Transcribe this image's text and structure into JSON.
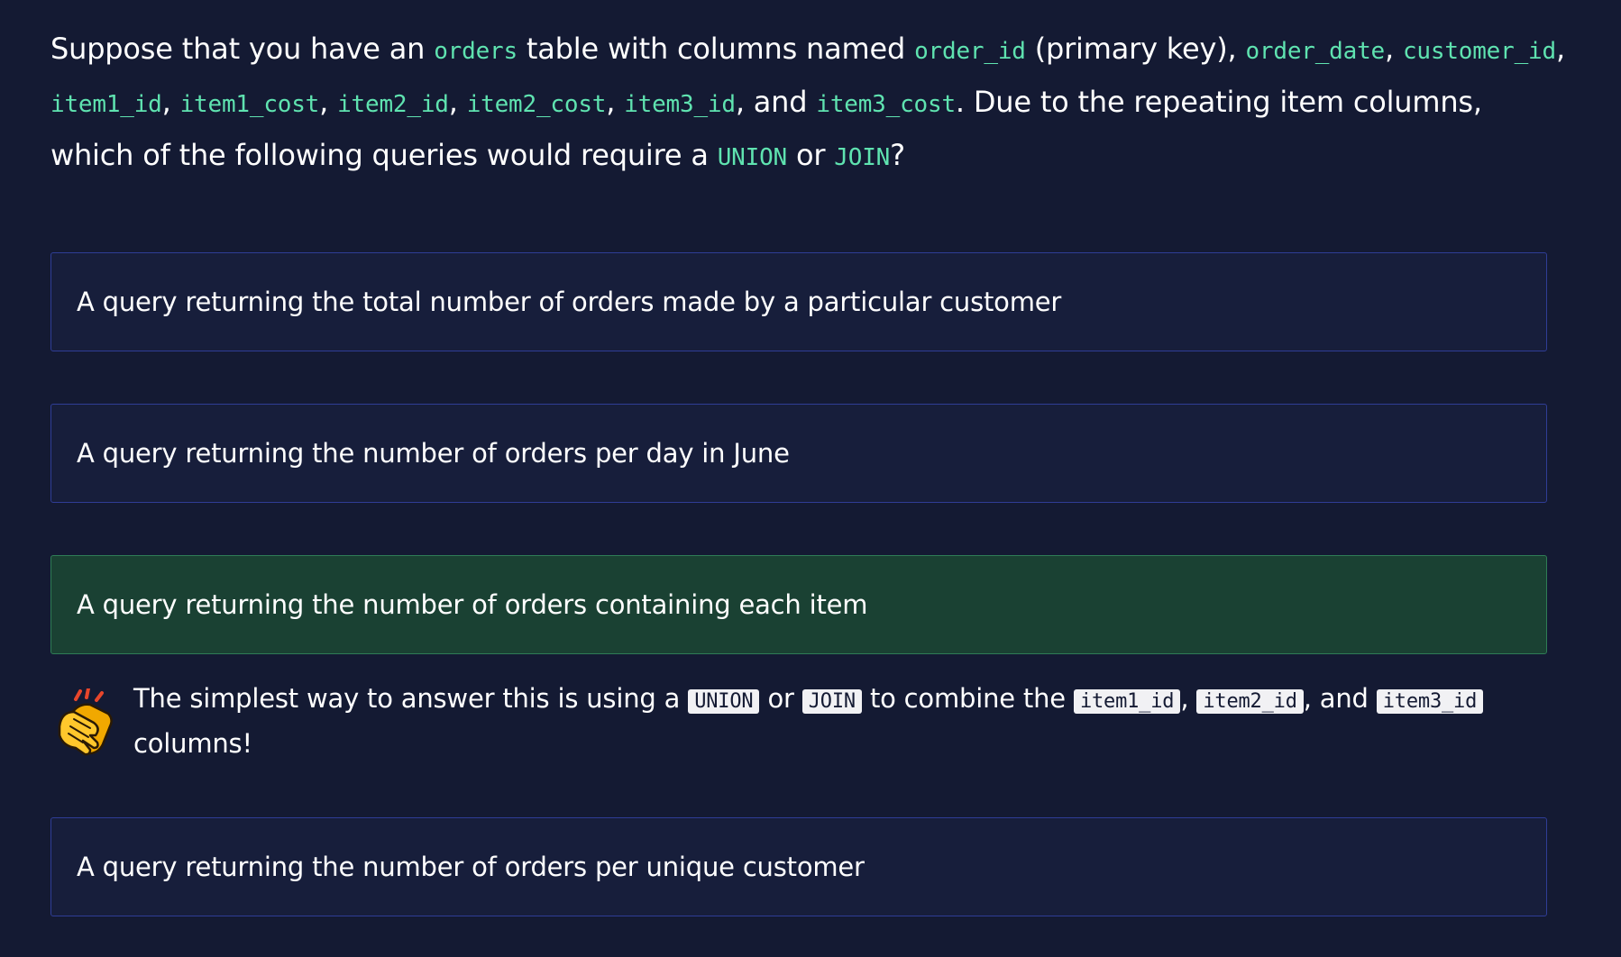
{
  "question": {
    "p1": "Suppose that you have an ",
    "c1": "orders",
    "p2": " table with columns named ",
    "c2": "order_id",
    "p3": " (primary key), ",
    "c3": "order_date",
    "p4": ", ",
    "c4": "customer_id",
    "p5": ", ",
    "c5": "item1_id",
    "p6": ", ",
    "c6": "item1_cost",
    "p7": ", ",
    "c7": "item2_id",
    "p8": ", ",
    "c8": "item2_cost",
    "p9": ", ",
    "c9": "item3_id",
    "p10": ", and ",
    "c10": "item3_cost",
    "p11": ". Due to the repeating item columns, which of the following queries would require a ",
    "c11": "UNION",
    "p12": " or ",
    "c12": "JOIN",
    "p13": "?"
  },
  "options": [
    {
      "label": "A query returning the total number of orders made by a particular customer"
    },
    {
      "label": "A query returning the number of orders per day in June"
    },
    {
      "label": "A query returning the number of orders containing each item"
    },
    {
      "label": "A query returning the number of orders per unique customer"
    }
  ],
  "feedback": {
    "icon": "clapping-hands-icon",
    "p1": "The simplest way to answer this is using a ",
    "c1": "UNION",
    "p2": " or ",
    "c2": "JOIN",
    "p3": " to combine the ",
    "c3": "item1_id",
    "p4": ", ",
    "c4": "item2_id",
    "p5": ", and ",
    "c5": "item3_id",
    "p6": " columns!"
  },
  "colors": {
    "background": "#141a33",
    "option_background": "#171e3b",
    "option_border": "#2f3d96",
    "correct_background": "#1a4133",
    "correct_border": "#2f7c56",
    "code_accent": "#5fe3b0"
  }
}
